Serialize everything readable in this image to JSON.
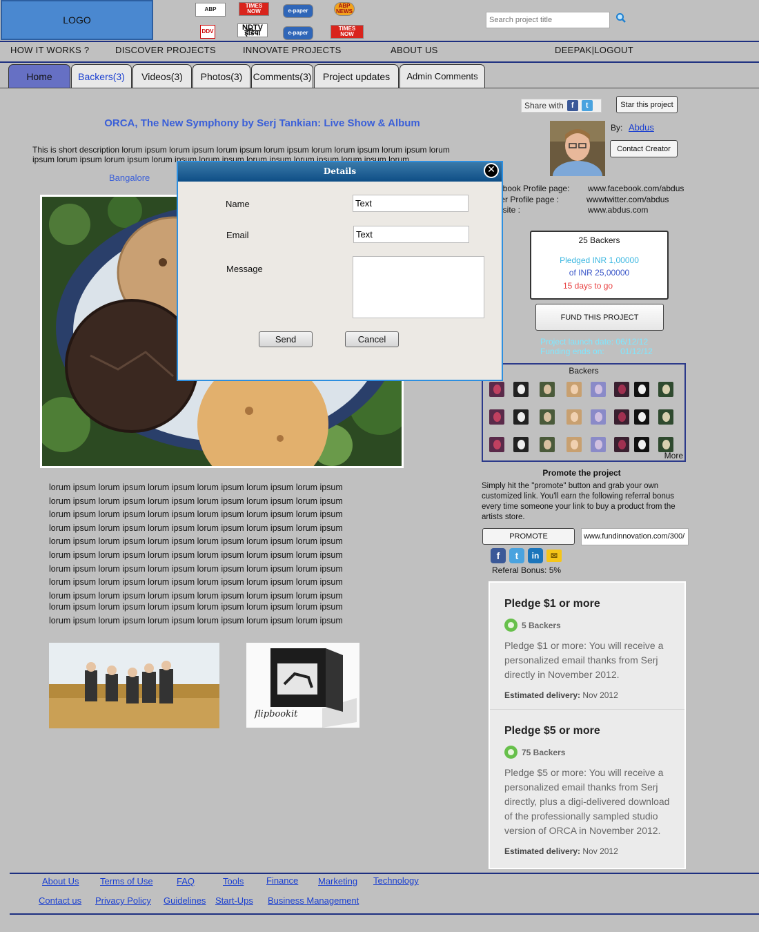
{
  "header": {
    "logo": "LOGO",
    "media_logos": [
      "ABP",
      "TIMES NOW",
      "e-paper",
      "ABP NEWS",
      "DDV",
      "NDTV इंडिया",
      "e-paper",
      "TIMES NOW"
    ],
    "search_placeholder": "Search project title",
    "search_icon": "search-icon"
  },
  "nav": {
    "how_it_works": "HOW IT WORKS ?",
    "discover": "DISCOVER PROJECTS",
    "innovate": "INNOVATE PROJECTS",
    "about": "ABOUT US",
    "user": "DEEPAK|LOGOUT"
  },
  "tabs": [
    "Home",
    "Backers(3)",
    "Videos(3)",
    "Photos(3)",
    "Comments(3)",
    "Project updates",
    "Admin Comments"
  ],
  "project": {
    "title": "ORCA, The New Symphony by Serj Tankian: Live Show & Album",
    "description": "This is short description lorum ipsum lorum ipsum lorum ipsum lorum ipsum lorum lorum ipsum lorum ipsum lorum ipsum lorum ipsum lorum ipsum lorum ipsum lorum ipsum lorum ipsum lorum ipsum lorum ipsum lorum",
    "location": "Bangalore",
    "body_lines": [
      "lorum ipsum lorum ipsum lorum ipsum lorum ipsum lorum ipsum lorum ipsum",
      "lorum ipsum lorum ipsum lorum ipsum lorum ipsum lorum ipsum lorum ipsum",
      "lorum ipsum lorum ipsum lorum ipsum lorum ipsum lorum ipsum lorum ipsum",
      "lorum ipsum lorum ipsum lorum ipsum lorum ipsum lorum ipsum lorum ipsum",
      "lorum ipsum lorum ipsum lorum ipsum lorum ipsum lorum ipsum lorum ipsum",
      "lorum ipsum lorum ipsum lorum ipsum lorum ipsum lorum ipsum lorum ipsum",
      "lorum ipsum lorum ipsum lorum ipsum lorum ipsum lorum ipsum lorum ipsum",
      "lorum ipsum lorum ipsum lorum ipsum lorum ipsum lorum ipsum lorum ipsum",
      "lorum ipsum lorum ipsum lorum ipsum lorum ipsum lorum ipsum lorum ipsum",
      "lorum ipsum lorum ipsum lorum ipsum lorum ipsum lorum ipsum lorum ipsum",
      "lorum ipsum lorum ipsum lorum ipsum lorum ipsum lorum ipsum lorum ipsum"
    ],
    "thumb2_caption": "flipbookit"
  },
  "sidebar": {
    "share_with": "Share with",
    "star_button": "Star this project",
    "by_label": "By:",
    "creator": "Abdus",
    "contact_creator": "Contact Creator",
    "profiles": [
      {
        "label": "ebook Profile page:",
        "value": "www.facebook.com/abdus"
      },
      {
        "label": "ter Profile page    :",
        "value": "wwwtwitter.com/abdus"
      },
      {
        "label": "bsite                    :",
        "value": "www.abdus.com"
      }
    ],
    "stats": {
      "backers": "25 Backers",
      "pledged": "Pledged INR 1,00000",
      "of_goal": "of INR 25,00000",
      "days_left": "15 days to go"
    },
    "fund_button": "FUND THIS PROJECT",
    "launch_date": "Project launch date: 06/12/12",
    "funding_ends": "Funding ends on:       01/12/12",
    "backers_title": "Backers",
    "backers_more": "More",
    "promote_title": "Promote the project",
    "promote_text": "Simply hit the \"promote\" button and grab your own customized link. You'll earn the following referral bonus every time someone your link to buy a product from the artists store.",
    "promote_button": "PROMOTE",
    "promote_link": "www.fundinnovation.com/300/",
    "referral_bonus": "Referal Bonus: 5%",
    "colors": {
      "pledged": "#3ab6e0",
      "of_goal": "#3a56c8",
      "days_left": "#e84040",
      "launch": "#7fe7ff"
    }
  },
  "pledges": [
    {
      "title": "Pledge $1 or more",
      "backers": "5 Backers",
      "desc": "Pledge $1 or more: You will receive a personalized email thanks from Serj directly in November 2012.",
      "delivery_label": "Estimated delivery:",
      "delivery": "Nov 2012"
    },
    {
      "title": "Pledge $5 or more",
      "backers": "75 Backers",
      "desc": "Pledge $5 or more: You will receive a personalized email thanks from Serj directly, plus a digi-delivered download of the professionally sampled studio version of ORCA in November 2012.",
      "delivery_label": "Estimated delivery:",
      "delivery": "Nov 2012"
    }
  ],
  "footer": {
    "row1": [
      "About Us",
      "Terms of Use",
      "FAQ",
      "Tools",
      "Finance",
      "Marketing",
      "Technology"
    ],
    "row2": [
      "Contact us",
      "Privacy Policy",
      "Guidelines",
      "Start-Ups",
      "Business Management"
    ]
  },
  "modal": {
    "title": "Details",
    "name_label": "Name",
    "name_value": "Text",
    "email_label": "Email",
    "email_value": "Text",
    "message_label": "Message",
    "send": "Send",
    "cancel": "Cancel"
  }
}
